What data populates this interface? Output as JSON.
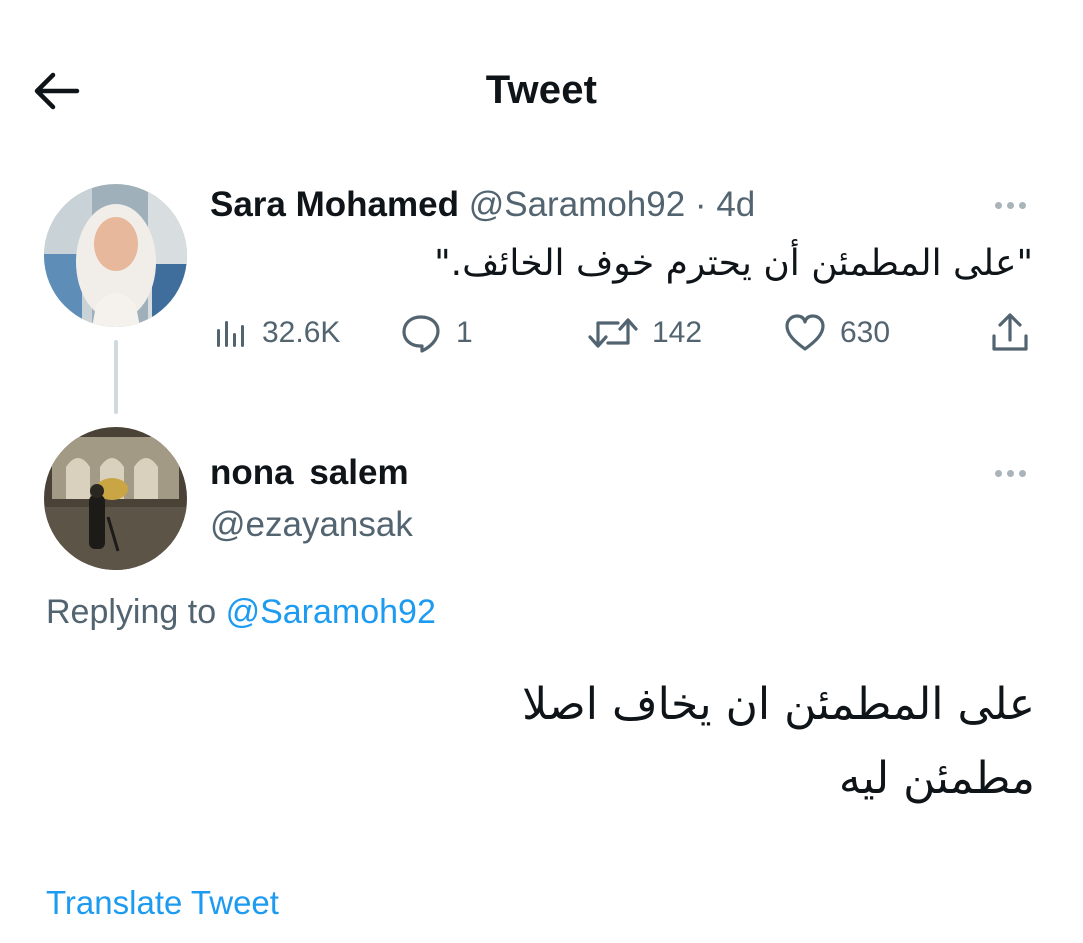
{
  "header": {
    "title": "Tweet",
    "back_icon": "arrow-left-icon"
  },
  "tweet": {
    "author_name": "Sara Mohamed",
    "author_handle": "@Saramoh92",
    "separator": "·",
    "time": "4d",
    "text": "\"على المطمئن أن يحترم خوف الخائف.\"",
    "stats": {
      "views": "32.6K",
      "replies": "1",
      "retweets": "142",
      "likes": "630"
    },
    "icons": [
      "analytics-icon",
      "reply-icon",
      "retweet-icon",
      "like-icon",
      "share-icon",
      "more-icon"
    ]
  },
  "reply": {
    "author_name": "nona  salem",
    "author_handle": "@ezayansak",
    "replying_prefix": "Replying to",
    "replying_handle": "@Saramoh92",
    "text_lines": [
      "على المطمئن ان يخاف اصلا",
      "مطمئن ليه"
    ],
    "translate_label": "Translate Tweet"
  },
  "colors": {
    "text": "#0f1419",
    "muted": "#536471",
    "link": "#1d9bf0",
    "background": "#ffffff"
  }
}
